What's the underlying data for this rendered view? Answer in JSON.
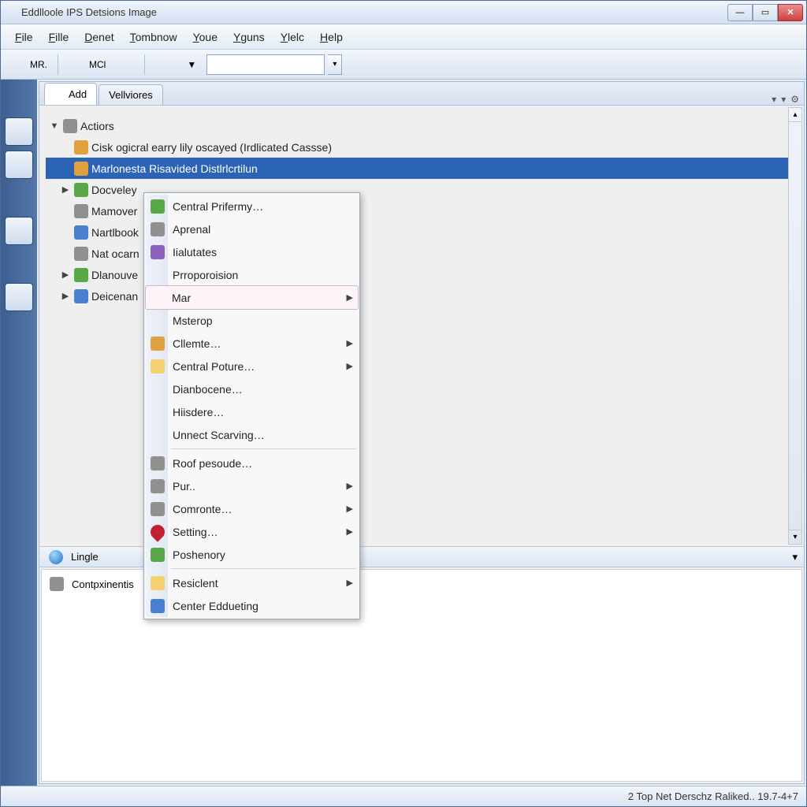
{
  "window": {
    "title": "Eddlloole IPS Detsions Image"
  },
  "menu": {
    "items": [
      {
        "l": "F",
        "r": "ile"
      },
      {
        "l": "F",
        "r": "ille"
      },
      {
        "l": "D",
        "r": "enet"
      },
      {
        "l": "T",
        "r": "ombnow"
      },
      {
        "l": "Y",
        "r": "oue"
      },
      {
        "l": "Y",
        "r": "guns"
      },
      {
        "l": "Y",
        "r": "lelc"
      },
      {
        "l": "H",
        "r": "elp"
      }
    ]
  },
  "toolbar": {
    "btn1": "MR.",
    "btn2": "MCl"
  },
  "tabs": {
    "tab1": "Add",
    "tab2": "Vellviores"
  },
  "tree": {
    "root": "Actiors",
    "items": [
      "Cisk ogicral earry lily oscayed (Irdlicated Cassse)",
      "Marlonesta Risavided Distlrlcrtilun",
      "Docveley",
      "Mamover",
      "Nartlbook",
      "Nat ocarn",
      "Dlanouve",
      "Deicenan"
    ]
  },
  "context": {
    "items": [
      {
        "label": "Central Prifermy…",
        "icon": "c-green"
      },
      {
        "label": "Aprenal",
        "icon": "c-gray"
      },
      {
        "label": "Iialutates",
        "icon": "c-purple"
      },
      {
        "label": "Prroporoision",
        "icon": ""
      },
      {
        "label": "Mar",
        "icon": "",
        "sub": true,
        "hovered": true
      },
      {
        "label": "Msterop",
        "icon": ""
      },
      {
        "label": "Cllemte…",
        "icon": "c-orange",
        "sub": true
      },
      {
        "label": "Central Poture…",
        "icon": "c-folder",
        "sub": true
      },
      {
        "label": "Dianbocene…",
        "icon": ""
      },
      {
        "label": "Hiisdere…",
        "icon": ""
      },
      {
        "label": "Unnect Scarving…",
        "icon": ""
      },
      {
        "sep": true
      },
      {
        "label": "Roof pesoude…",
        "icon": "c-gray"
      },
      {
        "label": "Pur..",
        "icon": "c-gray",
        "sub": true
      },
      {
        "label": "Comronte…",
        "icon": "c-gray",
        "sub": true
      },
      {
        "label": "Setting…",
        "icon": "c-heart",
        "sub": true
      },
      {
        "label": "Poshenory",
        "icon": "c-green"
      },
      {
        "sep": true
      },
      {
        "label": "Resiclent",
        "icon": "c-folder",
        "sub": true
      },
      {
        "label": "Center Eddueting",
        "icon": "c-blue"
      }
    ]
  },
  "lower": {
    "header": "Lingle",
    "row1": "Contpxinentis"
  },
  "status": {
    "left": "",
    "right": "2 Top Net Derschz Raliked.. 19.7-4+7"
  }
}
